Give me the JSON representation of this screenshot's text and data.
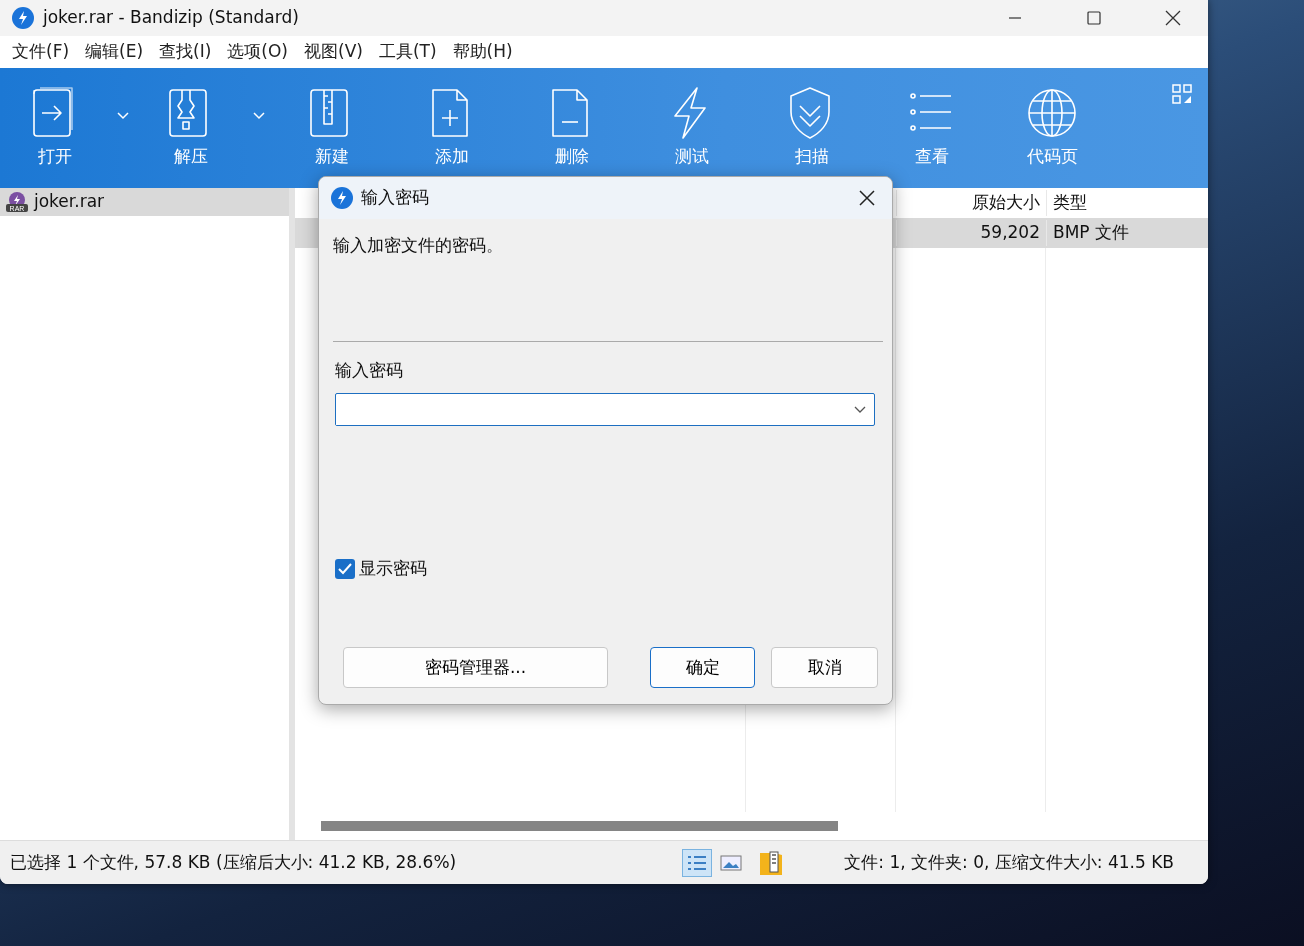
{
  "window": {
    "title": "joker.rar - Bandizip (Standard)"
  },
  "menu": [
    "文件(F)",
    "编辑(E)",
    "查找(I)",
    "选项(O)",
    "视图(V)",
    "工具(T)",
    "帮助(H)"
  ],
  "toolbar": [
    {
      "label": "打开",
      "kind": "open",
      "dropdown": true
    },
    {
      "label": "解压",
      "kind": "extract",
      "dropdown": true
    },
    {
      "label": "新建",
      "kind": "new",
      "dropdown": false
    },
    {
      "label": "添加",
      "kind": "add",
      "dropdown": false
    },
    {
      "label": "删除",
      "kind": "delete",
      "dropdown": false
    },
    {
      "label": "测试",
      "kind": "test",
      "dropdown": false
    },
    {
      "label": "扫描",
      "kind": "scan",
      "dropdown": false
    },
    {
      "label": "查看",
      "kind": "view",
      "dropdown": false
    },
    {
      "label": "代码页",
      "kind": "codepage",
      "dropdown": false
    }
  ],
  "tree": [
    {
      "label": "joker.rar",
      "icon_text": "RAR",
      "selected": true
    }
  ],
  "file_list": {
    "columns": [
      "原始大小",
      "类型"
    ],
    "rows": [
      {
        "cells": [
          "59,202",
          "BMP 文件"
        ],
        "selected": true
      }
    ]
  },
  "dialog": {
    "title": "输入密码",
    "message": "输入加密文件的密码。",
    "field_label": "输入密码",
    "show_password": {
      "label": "显示密码",
      "checked": true
    },
    "buttons": [
      {
        "label": "密码管理器...",
        "default": false
      },
      {
        "label": "确定",
        "default": true
      },
      {
        "label": "取消",
        "default": false
      }
    ]
  },
  "status_bar": {
    "left": "已选择 1 个文件, 57.8 KB (压缩后大小: 41.2 KB, 28.6%)",
    "right": "文件: 1, 文件夹: 0, 压缩文件大小: 41.5 KB"
  }
}
